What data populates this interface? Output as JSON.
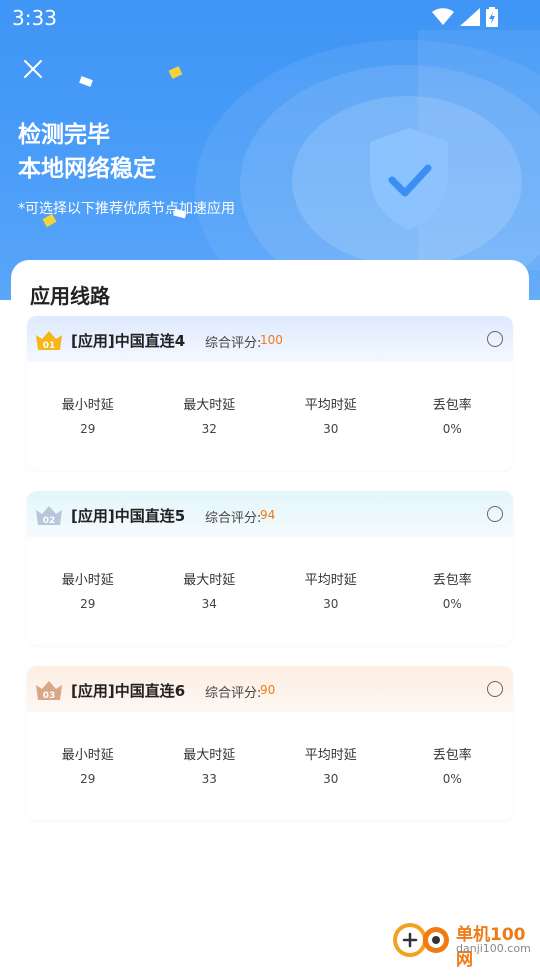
{
  "status_bar": {
    "time": "3:33"
  },
  "header": {
    "title_line1": "检测完毕",
    "title_line2": "本地网络稳定",
    "subtitle": "*可选择以下推荐优质节点加速应用"
  },
  "section_title": "应用线路",
  "score_label": "综合评分:",
  "stat_labels": [
    "最小时延",
    "最大时延",
    "平均时延",
    "丢包率"
  ],
  "routes": [
    {
      "rank": "01",
      "name": "[应用]中国直连4",
      "score": "100",
      "values": [
        "29",
        "32",
        "30",
        "0%"
      ]
    },
    {
      "rank": "02",
      "name": "[应用]中国直连5",
      "score": "94",
      "values": [
        "29",
        "34",
        "30",
        "0%"
      ]
    },
    {
      "rank": "03",
      "name": "[应用]中国直连6",
      "score": "90",
      "values": [
        "29",
        "33",
        "30",
        "0%"
      ]
    }
  ],
  "watermark": {
    "text": "单机100网",
    "url": "danji100.com"
  },
  "colors": {
    "hero_blue": "#3f95f6",
    "score_orange": "#f07a14",
    "gold": "#f6b618",
    "silver": "#b8c6dc",
    "bronze": "#d7a888"
  }
}
